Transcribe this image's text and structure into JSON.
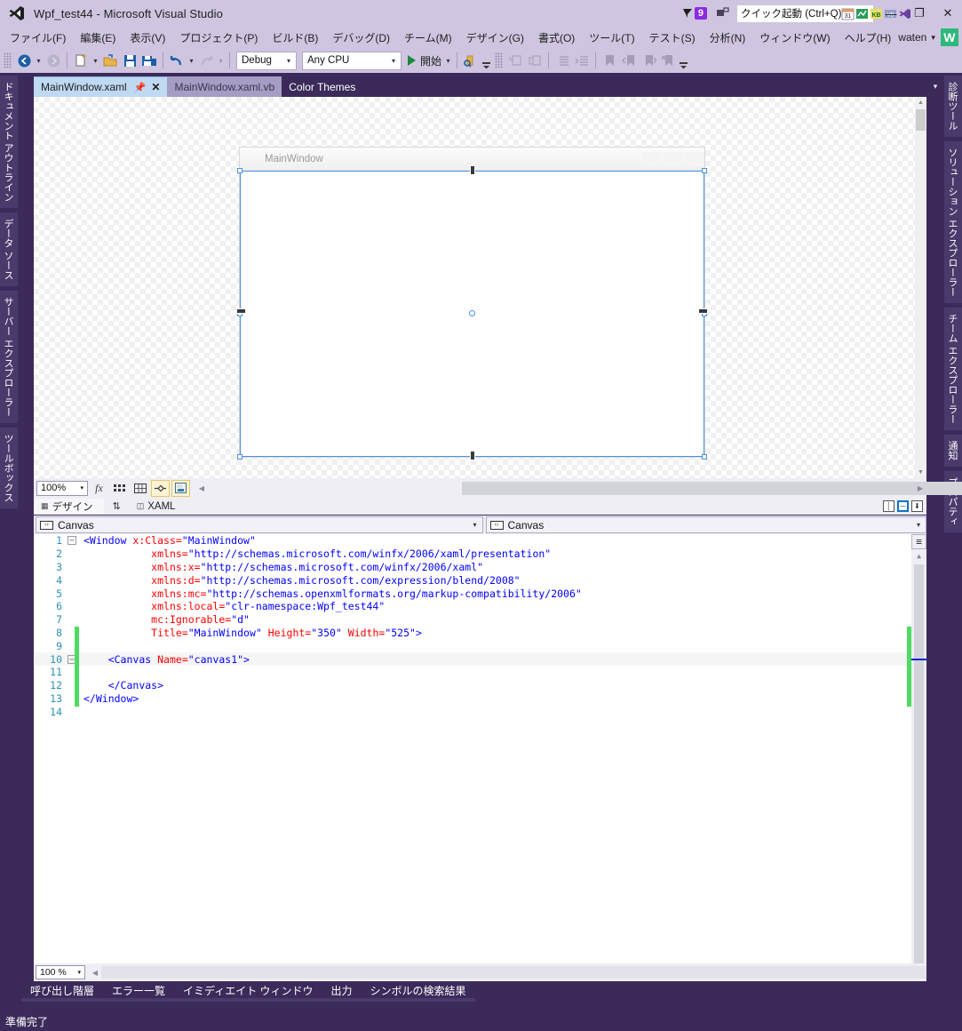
{
  "window": {
    "title": "Wpf_test44 - Microsoft Visual Studio",
    "logo_icon": "visual-studio-logo-icon",
    "minimize_label": "—",
    "maximize_label": "❐",
    "close_label": "✕"
  },
  "titlebar_right": {
    "feedback_icon": "feedback-flag-icon",
    "notification_count": "9",
    "screenshot_icon": "screen-capture-icon",
    "quick_launch_placeholder": "クイック起動 (Ctrl+Q)",
    "extra_icons": [
      "calendar-icon",
      "chart-icon",
      "kb-icon",
      "vb-icon",
      "vs-small-icon"
    ]
  },
  "menubar": {
    "items": [
      {
        "label": "ファイル(F)"
      },
      {
        "label": "編集(E)"
      },
      {
        "label": "表示(V)"
      },
      {
        "label": "プロジェクト(P)"
      },
      {
        "label": "ビルド(B)"
      },
      {
        "label": "デバッグ(D)"
      },
      {
        "label": "チーム(M)"
      },
      {
        "label": "デザイン(G)"
      },
      {
        "label": "書式(O)"
      },
      {
        "label": "ツール(T)"
      },
      {
        "label": "テスト(S)"
      },
      {
        "label": "分析(N)"
      },
      {
        "label": "ウィンドウ(W)"
      },
      {
        "label": "ヘルプ(H)"
      }
    ],
    "user_name": "waten",
    "user_caret": "▾",
    "avatar_letter": "W"
  },
  "toolbar": {
    "back_icon": "navigate-back-icon",
    "forward_icon": "navigate-forward-icon",
    "new_item_icon": "new-item-icon",
    "open_icon": "open-file-icon",
    "save_icon": "save-icon",
    "save_all_icon": "save-all-icon",
    "undo_icon": "undo-icon",
    "redo_icon": "redo-icon",
    "caret": "▾",
    "configuration": "Debug",
    "platform": "Any CPU",
    "run_label": "開始",
    "run_icon": "play-triangle-icon",
    "find_icon": "find-in-files-icon",
    "right_icons": [
      "comment-icon",
      "uncomment-icon",
      "indent-icon",
      "outdent-icon",
      "bookmark-icon",
      "prev-bookmark-icon",
      "next-bookmark-icon",
      "clear-bookmark-icon"
    ],
    "overflow_icon": "toolbar-overflow-icon"
  },
  "left_sidebar": {
    "tabs": [
      {
        "label": "ドキュメント アウトライン"
      },
      {
        "label": "データ ソース"
      },
      {
        "label": "サーバー エクスプローラー"
      },
      {
        "label": "ツールボックス"
      }
    ]
  },
  "right_sidebar": {
    "tabs": [
      {
        "label": "診断ツール"
      },
      {
        "label": "ソリューション エクスプローラー"
      },
      {
        "label": "チーム エクスプローラー"
      },
      {
        "label": "通知"
      },
      {
        "label": "プロパティ"
      }
    ]
  },
  "document_tabs": {
    "tabs": [
      {
        "label": "MainWindow.xaml",
        "state": "active",
        "pin_icon": "pin-icon",
        "close_icon": "✕"
      },
      {
        "label": "MainWindow.xaml.vb",
        "state": "inactive"
      },
      {
        "label": "Color Themes",
        "state": "plain"
      }
    ],
    "overflow_icon": "tab-overflow-icon"
  },
  "designer": {
    "preview_title": "MainWindow",
    "selection_element": "Canvas",
    "scroll_up_icon": "scroll-up-arrow-icon",
    "scroll_down_icon": "scroll-down-arrow-icon"
  },
  "designer_toolbar": {
    "zoom_value": "100%",
    "zoom_caret": "▾",
    "buttons": [
      {
        "name": "effects-button",
        "glyph": "fx",
        "selected": false
      },
      {
        "name": "grid-button",
        "glyph": "▓",
        "selected": false
      },
      {
        "name": "snap-grid-button",
        "glyph": "▦",
        "selected": false
      },
      {
        "name": "snap-to-guides-button",
        "glyph": "✦",
        "selected": true
      },
      {
        "name": "show-snap-lines-button",
        "glyph": "▤",
        "selected": true
      }
    ],
    "scroll_left_icon": "scroll-left-arrow-icon"
  },
  "split_tabs": {
    "design_label": "デザイン",
    "design_icon": "design-view-icon",
    "swap_icon": "⇅",
    "xaml_label": "XAML",
    "xaml_icon": "xaml-view-icon",
    "view_buttons": [
      {
        "name": "vertical-split-button",
        "glyph": "│",
        "active": false
      },
      {
        "name": "horizontal-split-button",
        "glyph": "─",
        "active": true
      },
      {
        "name": "collapse-pane-button",
        "glyph": "⬇",
        "active": false
      }
    ]
  },
  "nav_bar": {
    "left_value": "Canvas",
    "left_icon": "element-icon",
    "right_value": "Canvas",
    "right_icon": "element-icon",
    "caret": "▾"
  },
  "code": {
    "lines": [
      {
        "n": "1",
        "fold": "−",
        "tokens": [
          {
            "t": "<Window",
            "c": "k-tag"
          },
          {
            "t": " ",
            "c": "k-plain"
          },
          {
            "t": "x:Class=",
            "c": "k-attr"
          },
          {
            "t": "\"MainWindow\"",
            "c": "k-val"
          }
        ]
      },
      {
        "n": "2",
        "fold": "",
        "tokens": [
          {
            "t": "           ",
            "c": "k-plain"
          },
          {
            "t": "xmlns=",
            "c": "k-attr"
          },
          {
            "t": "\"http://schemas.microsoft.com/winfx/2006/xaml/presentation\"",
            "c": "k-val"
          }
        ]
      },
      {
        "n": "3",
        "fold": "",
        "tokens": [
          {
            "t": "           ",
            "c": "k-plain"
          },
          {
            "t": "xmlns:x=",
            "c": "k-attr"
          },
          {
            "t": "\"http://schemas.microsoft.com/winfx/2006/xaml\"",
            "c": "k-val"
          }
        ]
      },
      {
        "n": "4",
        "fold": "",
        "tokens": [
          {
            "t": "           ",
            "c": "k-plain"
          },
          {
            "t": "xmlns:d=",
            "c": "k-attr"
          },
          {
            "t": "\"http://schemas.microsoft.com/expression/blend/2008\"",
            "c": "k-val"
          }
        ]
      },
      {
        "n": "5",
        "fold": "",
        "tokens": [
          {
            "t": "           ",
            "c": "k-plain"
          },
          {
            "t": "xmlns:mc=",
            "c": "k-attr"
          },
          {
            "t": "\"http://schemas.openxmlformats.org/markup-compatibility/2006\"",
            "c": "k-val"
          }
        ]
      },
      {
        "n": "6",
        "fold": "",
        "tokens": [
          {
            "t": "           ",
            "c": "k-plain"
          },
          {
            "t": "xmlns:local=",
            "c": "k-attr"
          },
          {
            "t": "\"clr-namespace:Wpf_test44\"",
            "c": "k-val"
          }
        ]
      },
      {
        "n": "7",
        "fold": "",
        "tokens": [
          {
            "t": "           ",
            "c": "k-plain"
          },
          {
            "t": "mc:Ignorable=",
            "c": "k-attr"
          },
          {
            "t": "\"d\"",
            "c": "k-val"
          }
        ]
      },
      {
        "n": "8",
        "fold": "",
        "tokens": [
          {
            "t": "           ",
            "c": "k-plain"
          },
          {
            "t": "Title=",
            "c": "k-attr"
          },
          {
            "t": "\"MainWindow\"",
            "c": "k-val"
          },
          {
            "t": " ",
            "c": "k-plain"
          },
          {
            "t": "Height=",
            "c": "k-attr"
          },
          {
            "t": "\"350\"",
            "c": "k-val"
          },
          {
            "t": " ",
            "c": "k-plain"
          },
          {
            "t": "Width=",
            "c": "k-attr"
          },
          {
            "t": "\"525\"",
            "c": "k-val"
          },
          {
            "t": ">",
            "c": "k-tag"
          }
        ]
      },
      {
        "n": "9",
        "fold": "",
        "tokens": []
      },
      {
        "n": "10",
        "fold": "−",
        "highlight": true,
        "tokens": [
          {
            "t": "    ",
            "c": "k-plain"
          },
          {
            "t": "<Canvas",
            "c": "k-tag"
          },
          {
            "t": " ",
            "c": "k-plain"
          },
          {
            "t": "Name=",
            "c": "k-attr"
          },
          {
            "t": "\"canvas1\"",
            "c": "k-val"
          },
          {
            "t": ">",
            "c": "k-tag"
          }
        ]
      },
      {
        "n": "11",
        "fold": "",
        "tokens": []
      },
      {
        "n": "12",
        "fold": "",
        "tokens": [
          {
            "t": "    ",
            "c": "k-plain"
          },
          {
            "t": "</Canvas>",
            "c": "k-tag"
          }
        ]
      },
      {
        "n": "13",
        "fold": "",
        "tokens": [
          {
            "t": "</Window>",
            "c": "k-tag"
          }
        ]
      },
      {
        "n": "14",
        "fold": "",
        "tokens": []
      }
    ],
    "split_icon": "editor-split-icon",
    "scroll_up_icon": "scroll-up-arrow-icon"
  },
  "editor_bottom": {
    "zoom_value": "100 %",
    "zoom_caret": "▾",
    "scroll_left_icon": "scroll-left-arrow-icon"
  },
  "bottom_tabs": {
    "tabs": [
      {
        "label": "呼び出し階層"
      },
      {
        "label": "エラー一覧"
      },
      {
        "label": "イミディエイト ウィンドウ"
      },
      {
        "label": "出力"
      },
      {
        "label": "シンボルの検索結果"
      }
    ]
  },
  "statusbar": {
    "text": "準備完了"
  },
  "colors": {
    "chrome": "#cfc5e0",
    "dark_purple": "#3b2a5a",
    "accent_blue": "#4a90e2",
    "badge_purple": "#8a2be2",
    "run_green": "#1a8a3c",
    "change_green": "#4edb63"
  }
}
